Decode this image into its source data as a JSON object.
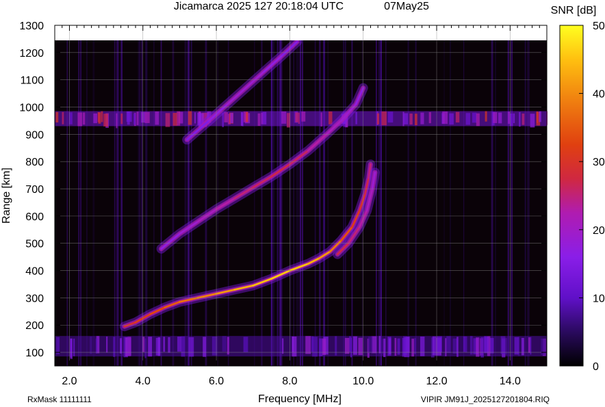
{
  "chart_data": {
    "type": "heatmap",
    "title": "Jicamarca 2025 127 20:18:04 UTC",
    "date_label": "07May25",
    "xlabel": "Frequency [MHz]",
    "ylabel": "Range [km]",
    "xlim": [
      1.6,
      15.0
    ],
    "ylim": [
      50,
      1300
    ],
    "xticks": [
      2.0,
      4.0,
      6.0,
      8.0,
      10.0,
      12.0,
      14.0
    ],
    "xtick_labels": [
      "2.0",
      "4.0",
      "6.0",
      "8.0",
      "10.0",
      "12.0",
      "14.0"
    ],
    "yticks": [
      100,
      200,
      300,
      400,
      500,
      600,
      700,
      800,
      900,
      1000,
      1100,
      1200,
      1300
    ],
    "ytick_labels": [
      "100",
      "200",
      "300",
      "400",
      "500",
      "600",
      "700",
      "800",
      "900",
      "1000",
      "1100",
      "1200",
      "1300"
    ],
    "data_top_range_km": 1245,
    "grid": true,
    "colorbar": {
      "label": "SNR [dB]",
      "range": [
        0,
        50
      ],
      "ticks": [
        0,
        10,
        20,
        30,
        40,
        50
      ],
      "tick_labels": [
        "0",
        "10",
        "20",
        "30",
        "40",
        "50"
      ]
    },
    "colors": {
      "background": "#0a0208",
      "low": "#3a0a55",
      "mid": "#8a1ee8",
      "high": "#d02828",
      "peak": "#ffd040"
    },
    "traces": [
      {
        "name": "O-mode F trace (1 hop)",
        "x": [
          3.5,
          3.8,
          4.2,
          4.6,
          5.0,
          5.5,
          6.0,
          6.5,
          7.0,
          7.5,
          8.0,
          8.5,
          8.8,
          9.1,
          9.4,
          9.7,
          9.9,
          10.05,
          10.15,
          10.2
        ],
        "y": [
          195,
          210,
          240,
          265,
          285,
          300,
          315,
          330,
          345,
          370,
          400,
          425,
          445,
          470,
          510,
          560,
          620,
          680,
          740,
          790
        ],
        "snr": [
          28,
          30,
          32,
          34,
          36,
          38,
          40,
          42,
          44,
          45,
          46,
          44,
          42,
          40,
          36,
          32,
          30,
          28,
          26,
          24
        ]
      },
      {
        "name": "X-mode F trace",
        "x": [
          9.3,
          9.6,
          9.9,
          10.1,
          10.25,
          10.32
        ],
        "y": [
          460,
          500,
          560,
          620,
          700,
          760
        ],
        "snr": [
          28,
          26,
          24,
          22,
          20,
          18
        ]
      },
      {
        "name": "Second hop F trace",
        "x": [
          4.5,
          5.0,
          5.5,
          6.0,
          6.5,
          7.0,
          7.5,
          8.0,
          8.5,
          9.0,
          9.4,
          9.8,
          10.0
        ],
        "y": [
          480,
          535,
          580,
          625,
          665,
          705,
          745,
          790,
          840,
          900,
          950,
          1010,
          1070
        ],
        "snr": [
          16,
          18,
          20,
          22,
          24,
          26,
          26,
          28,
          24,
          22,
          20,
          18,
          16
        ]
      },
      {
        "name": "Third hop F trace",
        "x": [
          5.2,
          5.8,
          6.3,
          6.8,
          7.3,
          7.8,
          8.2
        ],
        "y": [
          880,
          950,
          1010,
          1070,
          1130,
          1190,
          1240
        ],
        "snr": [
          14,
          16,
          18,
          20,
          18,
          16,
          14
        ]
      }
    ],
    "bands": [
      {
        "name": "Interference band",
        "y_range": [
          930,
          985
        ],
        "x_range": [
          1.6,
          15.0
        ],
        "snr": 22
      },
      {
        "name": "E-region / ground echoes",
        "y_range": [
          85,
          160
        ],
        "x_range": [
          1.6,
          15.0
        ],
        "snr": 14
      }
    ],
    "annotations": {
      "rx_mask": "RxMask 11111111",
      "file_label": "VIPIR  JM91J_2025127201804.RIQ"
    }
  }
}
